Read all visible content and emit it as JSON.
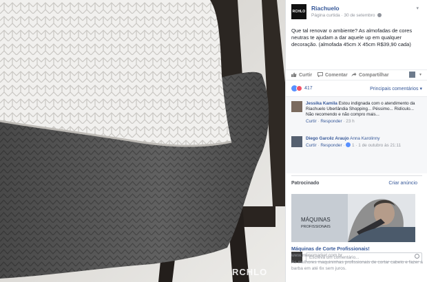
{
  "photo": {
    "watermark": "RCHLO"
  },
  "post": {
    "page_logo": "RCHLO",
    "page_name": "Riachuelo",
    "page_label": "Página curtida",
    "date": "30 de setembro",
    "text": "Que tal renovar o ambiente? As almofadas de cores neutras te ajudam a dar aquele up em qualquer decoração. (almofada 45cm X 45cm R$39,90 cada)",
    "actions": {
      "like": "Curtir",
      "comment": "Comentar",
      "share": "Compartilhar"
    },
    "reaction_count": "417",
    "sort_label": "Principais comentários ▾"
  },
  "comments": [
    {
      "name": "Jessika Kamila",
      "text": "Estou indignada com o atendimento da Riachuelo Uberlândia Shopping... Péssimo... Ridículo... Não recomendo e não compro mais...",
      "like": "Curtir",
      "reply": "Responder",
      "time": "23 h"
    },
    {
      "name": "Diego Garcêz Araujo",
      "text": "Anna Karolinny",
      "like": "Curtir",
      "reply": "Responder",
      "likes": "1",
      "time": "1 de outubro às 21:11"
    }
  ],
  "compose": {
    "placeholder": "Escreva um comentário..."
  },
  "ads": {
    "section_label": "Patrocinado",
    "create_link": "Criar anúncio",
    "image_caption_1": "MÁQUINAS",
    "image_caption_2": "PROFISSIONAIS",
    "title": "Máquinas de Corte Profissionais!",
    "url": "www.mensmarket.com.br",
    "description": "As melhores maquininhas profissionais de cortar cabelo e fazer a barba em até 6x sem juros."
  },
  "colors": {
    "link": "#365899",
    "muted": "#90949c",
    "like_blue": "#5890ff",
    "love_red": "#f25268"
  }
}
